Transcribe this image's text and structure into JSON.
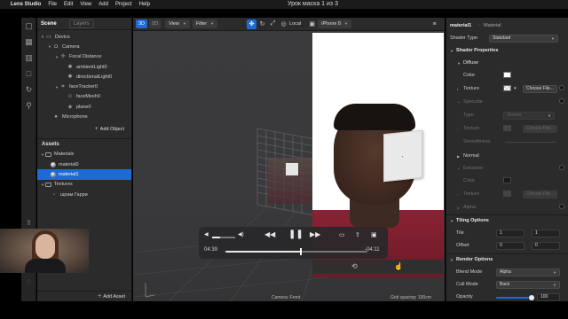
{
  "menubar": {
    "app": "Lens Studio",
    "items": [
      "File",
      "Edit",
      "View",
      "Add",
      "Project",
      "Help"
    ]
  },
  "window": {
    "title": "Урок маска 1 из 3"
  },
  "scene_panel": {
    "tabs": [
      "Scene",
      "Layers"
    ],
    "tree": [
      {
        "label": "Device",
        "depth": 0
      },
      {
        "label": "Camera",
        "depth": 1
      },
      {
        "label": "Focal Distance",
        "depth": 2
      },
      {
        "label": "ambientLight0",
        "depth": 3
      },
      {
        "label": "directionalLight0",
        "depth": 3
      },
      {
        "label": "faceTracker0",
        "depth": 2
      },
      {
        "label": "faceMesh0",
        "depth": 3
      },
      {
        "label": "plane0",
        "depth": 3
      },
      {
        "label": "Microphone",
        "depth": 1
      }
    ],
    "add_object": "Add Object",
    "assets_title": "Assets",
    "assets": [
      {
        "label": "Materials",
        "depth": 0
      },
      {
        "label": "material0",
        "depth": 1
      },
      {
        "label": "material1",
        "depth": 1,
        "selected": true
      },
      {
        "label": "Textures",
        "depth": 0
      },
      {
        "label": "шрам Гарри",
        "depth": 1
      }
    ],
    "add_asset": "Add Asset"
  },
  "viewport": {
    "mode_3d": "3D",
    "mode_2d": "2D",
    "view_label": "View",
    "filter_label": "Filter",
    "space_label": "Local",
    "device_label": "iPhone 8",
    "camera_status": "Camera: Front",
    "grid_status": "Grid spacing: 100cm"
  },
  "player": {
    "elapsed": "04:39",
    "remaining": "-04:11",
    "progress": 0.53,
    "volume": 0.35
  },
  "inspector": {
    "object_name": "material1",
    "object_type": "Material",
    "shader_type_label": "Shader Type",
    "shader_type_value": "Standard",
    "shader_properties": "Shader Properties",
    "diffuse": "Diffuse",
    "color": "Color",
    "texture": "Texture",
    "choose_file": "Choose File...",
    "specular": "Specular",
    "type": "Type",
    "type_value": "Texture",
    "smoothness": "Smoothness",
    "normal": "Normal",
    "emissive": "Emissive",
    "alpha": "Alpha",
    "tiling_options": "Tiling Options",
    "tile": "Tile",
    "tile_x": "1",
    "tile_y": "1",
    "offset": "Offset",
    "offset_x": "0",
    "offset_y": "0",
    "render_options": "Render Options",
    "blend_mode": "Blend Mode",
    "blend_mode_value": "Alpha",
    "cull_mode": "Cull Mode",
    "cull_mode_value": "Back",
    "opacity": "Opacity",
    "opacity_value": "100",
    "opacity_fraction": 1.0
  },
  "colors": {
    "accent": "#1e6bd6",
    "panel": "#2b2b2c",
    "viewport": "#3a3a3c"
  }
}
